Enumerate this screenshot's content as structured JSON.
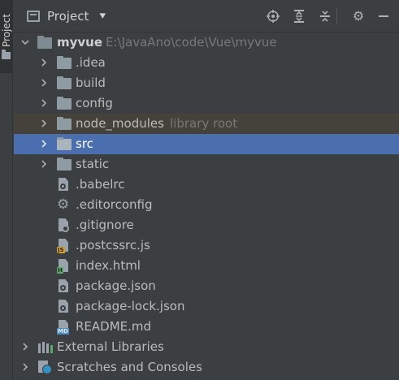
{
  "side_tab": {
    "label": "Project"
  },
  "header": {
    "title": "Project",
    "dropdown_icon": "caret-down-icon",
    "buttons": [
      {
        "name": "locate",
        "icon": "crosshair-icon"
      },
      {
        "name": "expand-all",
        "icon": "expand-all-icon"
      },
      {
        "name": "collapse-all",
        "icon": "collapse-all-icon"
      },
      {
        "name": "settings",
        "icon": "gear-icon"
      },
      {
        "name": "hide",
        "icon": "minimize-icon"
      }
    ]
  },
  "tree": {
    "root": {
      "name": "myvue",
      "path": "E:\\JavaAno\\code\\Vue\\myvue"
    },
    "folders": [
      {
        "name": ".idea"
      },
      {
        "name": "build"
      },
      {
        "name": "config"
      },
      {
        "name": "node_modules",
        "hint": "library root"
      },
      {
        "name": "src"
      },
      {
        "name": "static"
      }
    ],
    "files": [
      {
        "name": ".babelrc",
        "icon": "config-file-icon"
      },
      {
        "name": ".editorconfig",
        "icon": "gear-file-icon"
      },
      {
        "name": ".gitignore",
        "icon": "ignore-file-icon"
      },
      {
        "name": ".postcssrc.js",
        "icon": "js-file-icon",
        "badge": "JS"
      },
      {
        "name": "index.html",
        "icon": "html-file-icon",
        "badge": "H"
      },
      {
        "name": "package.json",
        "icon": "json-file-icon"
      },
      {
        "name": "package-lock.json",
        "icon": "json-file-icon"
      },
      {
        "name": "README.md",
        "icon": "markdown-file-icon",
        "badge": "MD"
      }
    ],
    "external_libraries": "External Libraries",
    "scratches": "Scratches and Consoles"
  },
  "colors": {
    "background": "#3c3f41",
    "selected": "#4b6eaf",
    "library_highlight": "#45413b"
  }
}
